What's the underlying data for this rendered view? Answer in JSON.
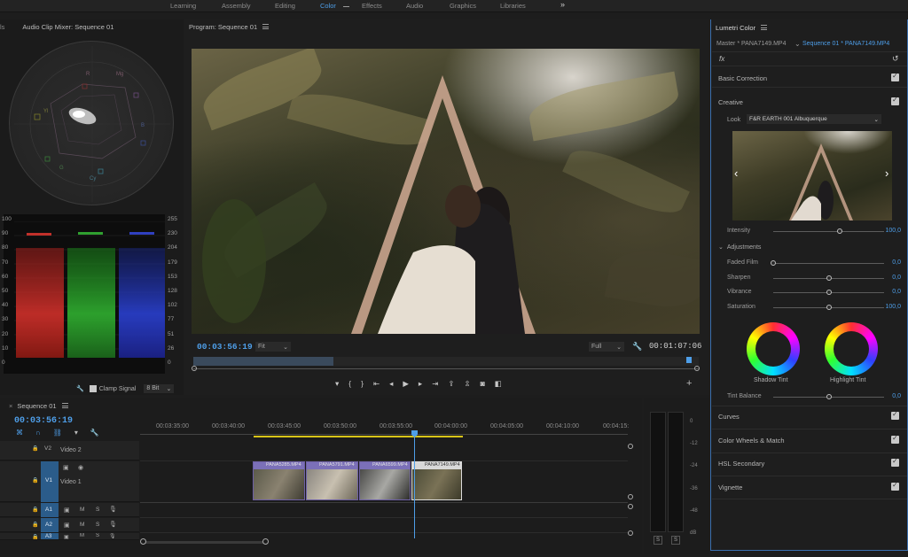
{
  "workspace_tabs": [
    {
      "label": "Learning"
    },
    {
      "label": "Assembly"
    },
    {
      "label": "Editing"
    },
    {
      "label": "Color",
      "active": true
    },
    {
      "label": "Effects"
    },
    {
      "label": "Audio"
    },
    {
      "label": "Graphics"
    },
    {
      "label": "Libraries"
    }
  ],
  "scopes": {
    "left_label": "ls",
    "panel_title": "Audio Clip Mixer: Sequence 01",
    "vectorscope_labels": [
      "R",
      "Mg",
      "B",
      "Cy",
      "G",
      "Yl"
    ],
    "parade_left_ticks": [
      "100",
      "90",
      "80",
      "70",
      "60",
      "50",
      "40",
      "30",
      "20",
      "10",
      "0"
    ],
    "parade_right_ticks": [
      "255",
      "230",
      "204",
      "179",
      "153",
      "128",
      "102",
      "77",
      "51",
      "26",
      "0"
    ],
    "clamp_signal_label": "Clamp Signal",
    "bit_depth": "8 Bit"
  },
  "program": {
    "title": "Program: Sequence 01",
    "current_time": "00:03:56:19",
    "fit_label": "Fit",
    "resolution_label": "Full",
    "duration": "00:01:07:06"
  },
  "lumetri": {
    "title": "Lumetri Color",
    "master_label": "Master * PANA7149.MP4",
    "sequence_label": "Sequence 01 * PANA7149.MP4",
    "fx_label": "fx",
    "sections_top": [
      "Basic Correction",
      "Creative"
    ],
    "look_label": "Look",
    "look_value": "F&R EARTH 001 Albuquerque",
    "intensity": {
      "label": "Intensity",
      "value": "100,0",
      "fraction": 0.6
    },
    "adjustments_label": "Adjustments",
    "sliders": [
      {
        "label": "Faded Film",
        "value": "0,0",
        "fraction": 0.0
      },
      {
        "label": "Sharpen",
        "value": "0,0",
        "fraction": 0.5
      },
      {
        "label": "Vibrance",
        "value": "0,0",
        "fraction": 0.5
      },
      {
        "label": "Saturation",
        "value": "100,0",
        "fraction": 0.5
      }
    ],
    "shadow_tint_label": "Shadow Tint",
    "highlight_tint_label": "Highlight Tint",
    "tint_balance": {
      "label": "Tint Balance",
      "value": "0,0",
      "fraction": 0.5
    },
    "sections_bottom": [
      "Curves",
      "Color Wheels & Match",
      "HSL Secondary",
      "Vignette"
    ]
  },
  "timeline": {
    "tab_title": "Sequence 01",
    "current_time": "00:03:56:19",
    "ruler": [
      "00:03:35:00",
      "00:03:40:00",
      "00:03:45:00",
      "00:03:50:00",
      "00:03:55:00",
      "00:04:00:00",
      "00:04:05:00",
      "00:04:10:00",
      "00:04:15:"
    ],
    "tracks": [
      {
        "id": "V2",
        "name": "Video 2"
      },
      {
        "id": "V1",
        "name": "Video 1"
      },
      {
        "id": "A1"
      },
      {
        "id": "A2"
      },
      {
        "id": "A3"
      }
    ],
    "audio_buttons": [
      "M",
      "S"
    ],
    "clips": [
      "PANA5285.MP4",
      "PANA5791.MP4",
      "PANA6599.MP4",
      "PANA7149.MP4"
    ]
  },
  "meter": {
    "ticks": [
      "0",
      "-12",
      "-24",
      "-36",
      "-48",
      "dB"
    ],
    "solo_labels": [
      "S",
      "S"
    ]
  },
  "colors": {
    "accent": "#4e9ee8",
    "clip": "#7a6fb0",
    "playhead": "#4e9ee8"
  }
}
